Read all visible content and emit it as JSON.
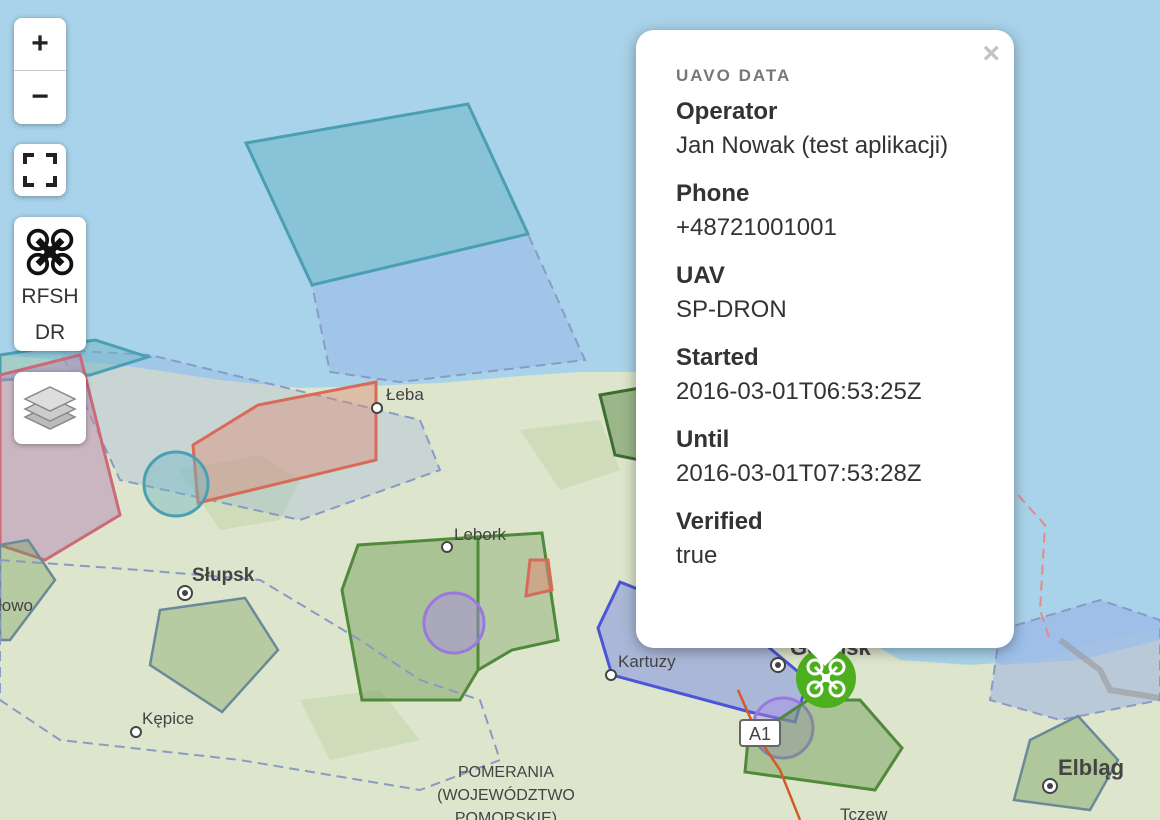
{
  "controls": {
    "zoom_in": "+",
    "zoom_out": "−",
    "refresh_line1": "RFSH",
    "refresh_line2": "DR"
  },
  "map": {
    "places": [
      "Łeba",
      "Lebork",
      "Słupsk",
      "Kępice",
      "Kartuzy",
      "Gdańsk",
      "Elbląg",
      "Tczew"
    ],
    "region_line1": "POMERANIA",
    "region_line2": "(WOJEWÓDZTWO",
    "region_line3": "POMORSKIE)",
    "partial_label": "łowo",
    "road_label": "A1"
  },
  "popup": {
    "title": "UAVO DATA",
    "close": "×",
    "fields": [
      {
        "label": "Operator",
        "value": "Jan Nowak (test aplikacji)"
      },
      {
        "label": "Phone",
        "value": "+48721001001"
      },
      {
        "label": "UAV",
        "value": "SP-DRON"
      },
      {
        "label": "Started",
        "value": "2016-03-01T06:53:25Z"
      },
      {
        "label": "Until",
        "value": "2016-03-01T07:53:28Z"
      },
      {
        "label": "Verified",
        "value": "true"
      }
    ]
  },
  "colors": {
    "sea": "#a9d3ea",
    "land": "#dfe6cf",
    "zone_blue": "#6f8fe0",
    "zone_teal": "#4fa3b5",
    "zone_red": "#d2695a",
    "zone_green": "#5a8a46",
    "zone_purple": "#9a78e0",
    "marker": "#4caf1d"
  }
}
